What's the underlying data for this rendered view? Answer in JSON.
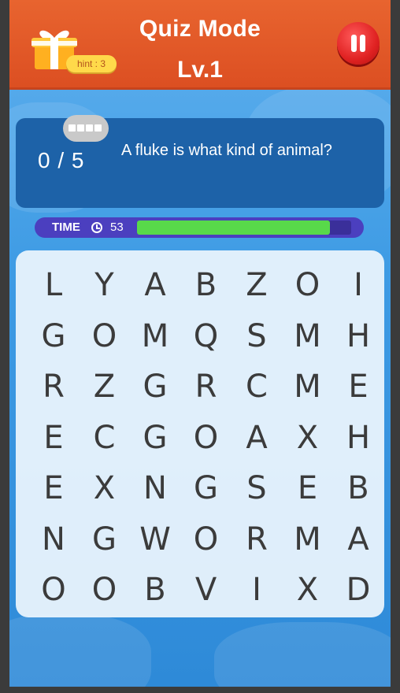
{
  "header": {
    "title": "Quiz Mode",
    "level": "Lv.1",
    "hint_label": "hint : 3"
  },
  "quiz": {
    "score": "0 / 5",
    "found": 0,
    "total": 5,
    "question": "A fluke is what kind of animal?"
  },
  "timer": {
    "label": "TIME",
    "value": "53",
    "remaining_fraction": 0.9
  },
  "grid": {
    "rows": [
      [
        "L",
        "Y",
        "A",
        "B",
        "Z",
        "O",
        "I"
      ],
      [
        "G",
        "O",
        "M",
        "Q",
        "S",
        "M",
        "H"
      ],
      [
        "R",
        "Z",
        "G",
        "R",
        "C",
        "M",
        "E"
      ],
      [
        "E",
        "C",
        "G",
        "O",
        "A",
        "X",
        "H"
      ],
      [
        "E",
        "X",
        "N",
        "G",
        "S",
        "E",
        "B"
      ],
      [
        "N",
        "G",
        "W",
        "O",
        "R",
        "M",
        "A"
      ],
      [
        "O",
        "O",
        "B",
        "V",
        "I",
        "X",
        "D"
      ]
    ]
  },
  "icons": {
    "gift": "gift-icon",
    "pause": "pause-icon",
    "clock": "clock-icon"
  },
  "colors": {
    "header": "#dc4f22",
    "panel": "#1d62a8",
    "timer_bar": "#4b3fbf",
    "timer_fill": "#58d94a",
    "pause": "#e02222"
  }
}
